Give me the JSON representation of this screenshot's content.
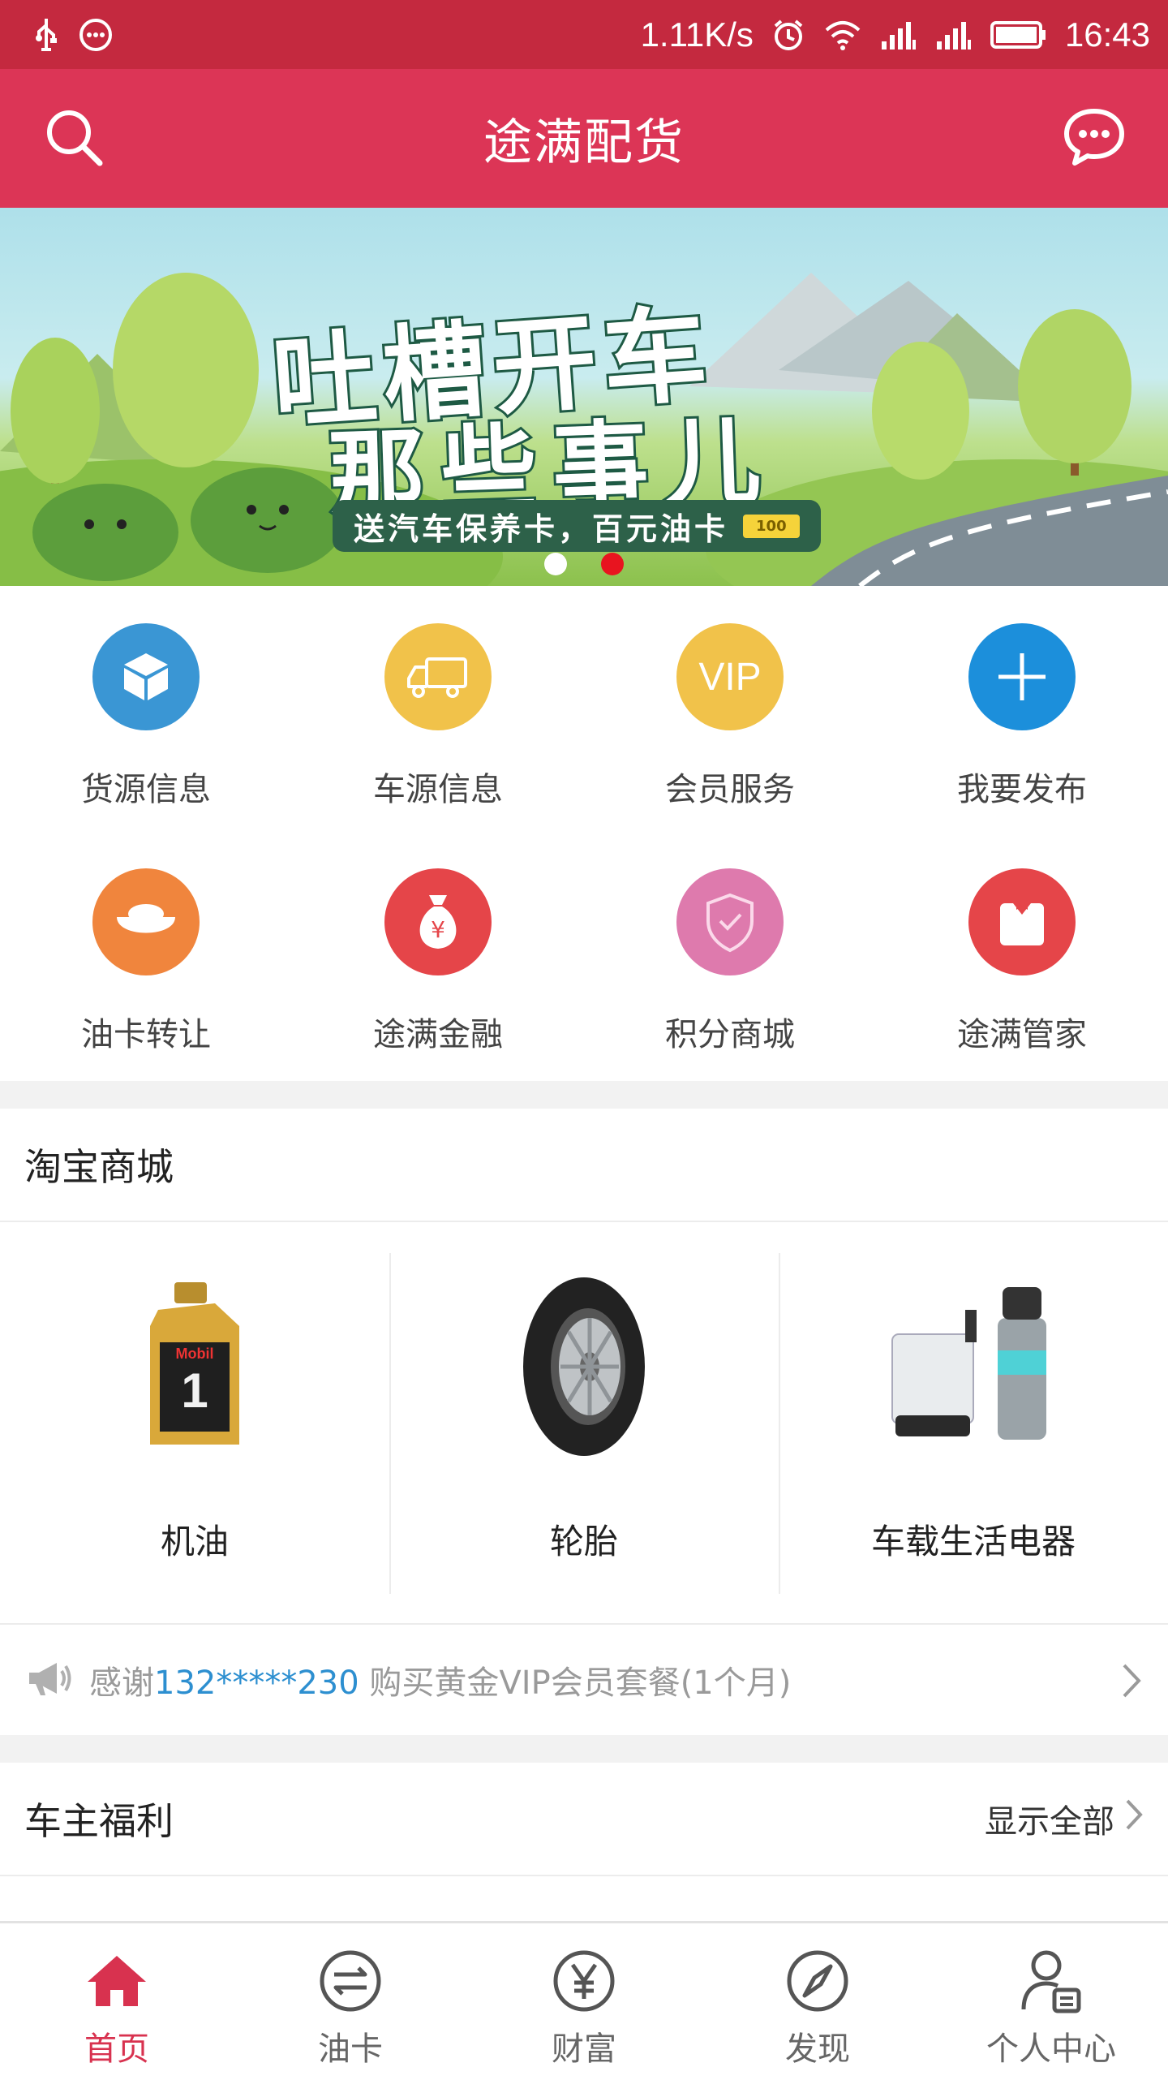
{
  "status_bar": {
    "speed": "1.11K/s",
    "time": "16:43",
    "icons": [
      "usb-icon",
      "more-icon",
      "alarm-icon",
      "wifi-icon",
      "signal-icon",
      "signal-icon",
      "battery-icon"
    ]
  },
  "header": {
    "title": "途满配货",
    "left_icon": "search-icon",
    "right_icon": "message-icon"
  },
  "banner": {
    "line1": "吐槽开车",
    "line2": "那些事儿",
    "subtitle": "送汽车保养卡，百元油卡",
    "coupon": "100",
    "active_dot": 0,
    "dot_count": 2
  },
  "grid": [
    {
      "label": "货源信息",
      "icon": "box-icon",
      "color": "#3a96d4"
    },
    {
      "label": "车源信息",
      "icon": "truck-icon",
      "color": "#f1c24a"
    },
    {
      "label": "会员服务",
      "icon": "vip-icon",
      "color": "#f1c24a",
      "text": "VIP"
    },
    {
      "label": "我要发布",
      "icon": "plus-icon",
      "color": "#1c8fdb"
    },
    {
      "label": "油卡转让",
      "icon": "gold-ingot-icon",
      "color": "#f0853d"
    },
    {
      "label": "途满金融",
      "icon": "money-bag-icon",
      "color": "#e54549"
    },
    {
      "label": "积分商城",
      "icon": "shield-icon",
      "color": "#de7aad"
    },
    {
      "label": "途满管家",
      "icon": "butler-icon",
      "color": "#e54549"
    }
  ],
  "taobao": {
    "title": "淘宝商城",
    "products": [
      {
        "label": "机油",
        "icon": "oil-bottle-icon"
      },
      {
        "label": "轮胎",
        "icon": "tire-icon"
      },
      {
        "label": "车载生活电器",
        "icon": "car-appliance-icon"
      }
    ]
  },
  "notice": {
    "prefix": "感谢",
    "phone": "132*****230",
    "suffix": " 购买黄金VIP会员套餐(1个月)"
  },
  "benefits": {
    "title": "车主福利",
    "show_all": "显示全部"
  },
  "tabs": [
    {
      "label": "首页",
      "icon": "home-icon",
      "active": true
    },
    {
      "label": "油卡",
      "icon": "exchange-icon",
      "active": false
    },
    {
      "label": "财富",
      "icon": "yuan-icon",
      "active": false
    },
    {
      "label": "发现",
      "icon": "compass-icon",
      "active": false
    },
    {
      "label": "个人中心",
      "icon": "profile-icon",
      "active": false
    }
  ],
  "colors": {
    "status_bar": "#c4293f",
    "header": "#dc3556",
    "accent": "#d8324f",
    "link": "#2d8fd0"
  }
}
